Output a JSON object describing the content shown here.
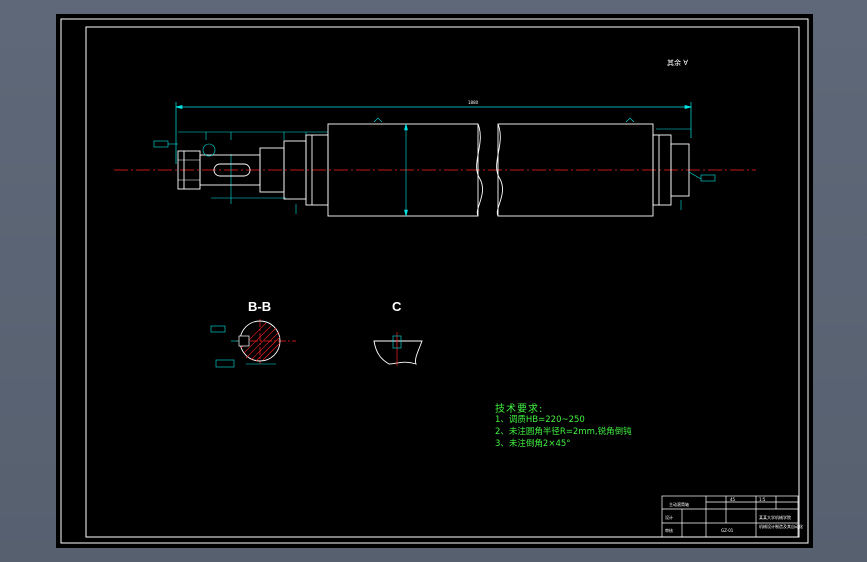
{
  "drawing": {
    "corner_mark": "其余 ∀",
    "overall_length_label": "1880"
  },
  "sections": {
    "bb_title": "B-B",
    "c_title": "C"
  },
  "tech_requirements": {
    "title": "技术要求:",
    "items": [
      "1、调质HB=220~250",
      "2、未注圆角半径R=2mm,锐角倒钝",
      "3、未注倒角2×45°"
    ]
  },
  "title_block": {
    "part_name": "主动滚筒轴",
    "material": "45",
    "scale": "1:5",
    "designer_label": "设计",
    "checker_label": "审核",
    "drawing_no": "GZ-01",
    "school": "某某大学机械学院",
    "school_line2": "机械设计制造及其自动化"
  },
  "colors": {
    "background": "#000000",
    "outline": "#ffffff",
    "dimension": "#00e5e5",
    "centerline": "#ff2020",
    "hatch": "#ff2020",
    "notes": "#41f241",
    "workspace": "#5d6676"
  }
}
